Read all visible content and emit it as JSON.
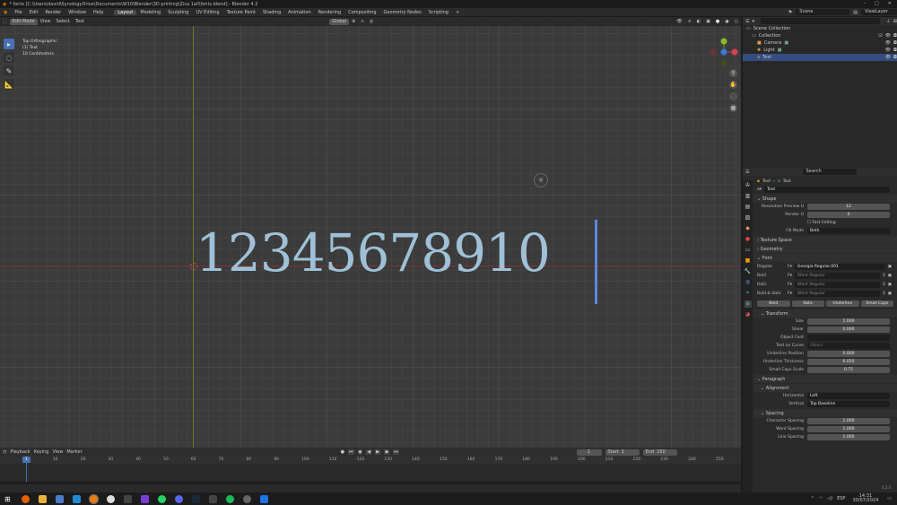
{
  "title": "* fonts [C:\\Users\\david\\SynologyDrive\\Documents\\W10\\Blender\\3D printing\\Zica 1all\\fonts.blend] - Blender 4.2",
  "window_controls": [
    "–",
    "□",
    "✕"
  ],
  "menu": [
    "File",
    "Edit",
    "Render",
    "Window",
    "Help"
  ],
  "workspaces": [
    "Layout",
    "Modeling",
    "Sculpting",
    "UV Editing",
    "Texture Paint",
    "Shading",
    "Animation",
    "Rendering",
    "Compositing",
    "Geometry Nodes",
    "Scripting",
    "+"
  ],
  "scene": "Scene",
  "view_layer": "ViewLayer",
  "viewport": {
    "mode": "Edit Mode",
    "menus": [
      "View",
      "Select",
      "Text"
    ],
    "transform": "Global",
    "overlay_info": [
      "Top Orthographic",
      "(1) Text",
      "10 Centimeters"
    ],
    "text": "12345678910"
  },
  "outliner": {
    "search_placeholder": "",
    "items": [
      {
        "label": "Scene Collection"
      },
      {
        "label": "Collection"
      },
      {
        "label": "Camera"
      },
      {
        "label": "Light"
      },
      {
        "label": "Text"
      }
    ]
  },
  "properties": {
    "search_placeholder": "Search",
    "breadcrumb": [
      "Text",
      "Text"
    ],
    "datablock": "Text",
    "shape": {
      "header": "Shape",
      "resolution_preview_label": "Resolution Preview U",
      "resolution_preview": "12",
      "render_label": "Render U",
      "render": "0",
      "fast_editing": "Fast Editing",
      "fill_mode_label": "Fill Mode",
      "fill_mode": "Both"
    },
    "texture_space": "Texture Space",
    "geometry": "Geometry",
    "font": {
      "header": "Font",
      "regular_label": "Regular",
      "regular": "Georgia Regular.001",
      "bold_label": "Bold",
      "bold": "Bfont Regular",
      "italic_label": "Italic",
      "italic": "Bfont Regular",
      "bold_italic_label": "Bold & Italic",
      "bold_italic": "Bfont Regular",
      "users": "3",
      "style_buttons": [
        "Bold",
        "Italic",
        "Underline",
        "Small Caps"
      ]
    },
    "transform": {
      "header": "Transform",
      "size_label": "Size",
      "size": "1.000",
      "shear_label": "Shear",
      "shear": "0.000",
      "object_font_label": "Object Font",
      "text_on_curve_label": "Text on Curve",
      "text_on_curve_placeholder": "Object",
      "underline_position_label": "Underline Position",
      "underline_position": "0.000",
      "underline_thickness_label": "Underline Thickness",
      "underline_thickness": "0.050",
      "small_caps_label": "Small Caps Scale",
      "small_caps": "0.75"
    },
    "paragraph": {
      "header": "Paragraph",
      "alignment_header": "Alignment",
      "horizontal_label": "Horizontal",
      "horizontal": "Left",
      "vertical_label": "Vertical",
      "vertical": "Top Baseline",
      "spacing_header": "Spacing",
      "char_spacing_label": "Character Spacing",
      "char_spacing": "1.000",
      "word_spacing_label": "Word Spacing",
      "word_spacing": "1.000",
      "line_spacing_label": "Line Spacing",
      "line_spacing": "1.000"
    }
  },
  "timeline": {
    "menus": [
      "Playback",
      "Keying",
      "View",
      "Marker"
    ],
    "current_frame": "1",
    "start_label": "Start",
    "start": "1",
    "end_label": "End",
    "end": "250",
    "ticks": [
      "0",
      "10",
      "20",
      "30",
      "40",
      "50",
      "60",
      "70",
      "80",
      "90",
      "100",
      "110",
      "120",
      "130",
      "140",
      "150",
      "160",
      "170",
      "180",
      "190",
      "200",
      "210",
      "220",
      "230",
      "240",
      "250"
    ]
  },
  "status_version": "4.2.0",
  "taskbar": {
    "lang": "ESP",
    "time": "14:31",
    "date": "30/07/2024"
  },
  "colors": {
    "accent": "#4772b3",
    "text_color": "#9fc0d6",
    "cursor": "#5f87d9",
    "selected": "#334d80"
  }
}
